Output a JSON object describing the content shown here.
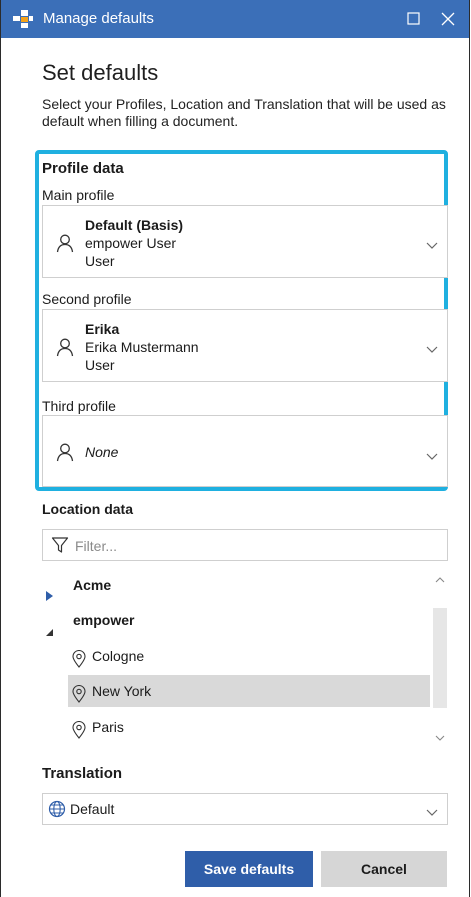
{
  "window": {
    "title": "Manage defaults",
    "controls": {
      "maximize_icon": "maximize-icon",
      "close_icon": "close-icon"
    },
    "titlebar_color": "#3b6fb8"
  },
  "header": {
    "heading": "Set defaults",
    "intro": "Select your Profiles, Location and Translation that will be used as default when filling a document."
  },
  "profile_data": {
    "title": "Profile data",
    "highlight_color": "#1fb0e0",
    "main": {
      "label": "Main profile",
      "name": "Default (Basis)",
      "line2": "empower User",
      "line3": "User"
    },
    "second": {
      "label": "Second profile",
      "name": "Erika",
      "line2": "Erika Mustermann",
      "line3": "User"
    },
    "third": {
      "label": "Third profile",
      "value": "None"
    }
  },
  "location_data": {
    "title": "Location data",
    "filter_placeholder": "Filter...",
    "groups": [
      {
        "name": "Acme",
        "expanded": false
      },
      {
        "name": "empower",
        "expanded": true,
        "items": [
          "Cologne",
          "New York",
          "Paris"
        ],
        "selected": "New York"
      }
    ]
  },
  "translation": {
    "title": "Translation",
    "value": "Default"
  },
  "buttons": {
    "save": "Save defaults",
    "cancel": "Cancel"
  }
}
